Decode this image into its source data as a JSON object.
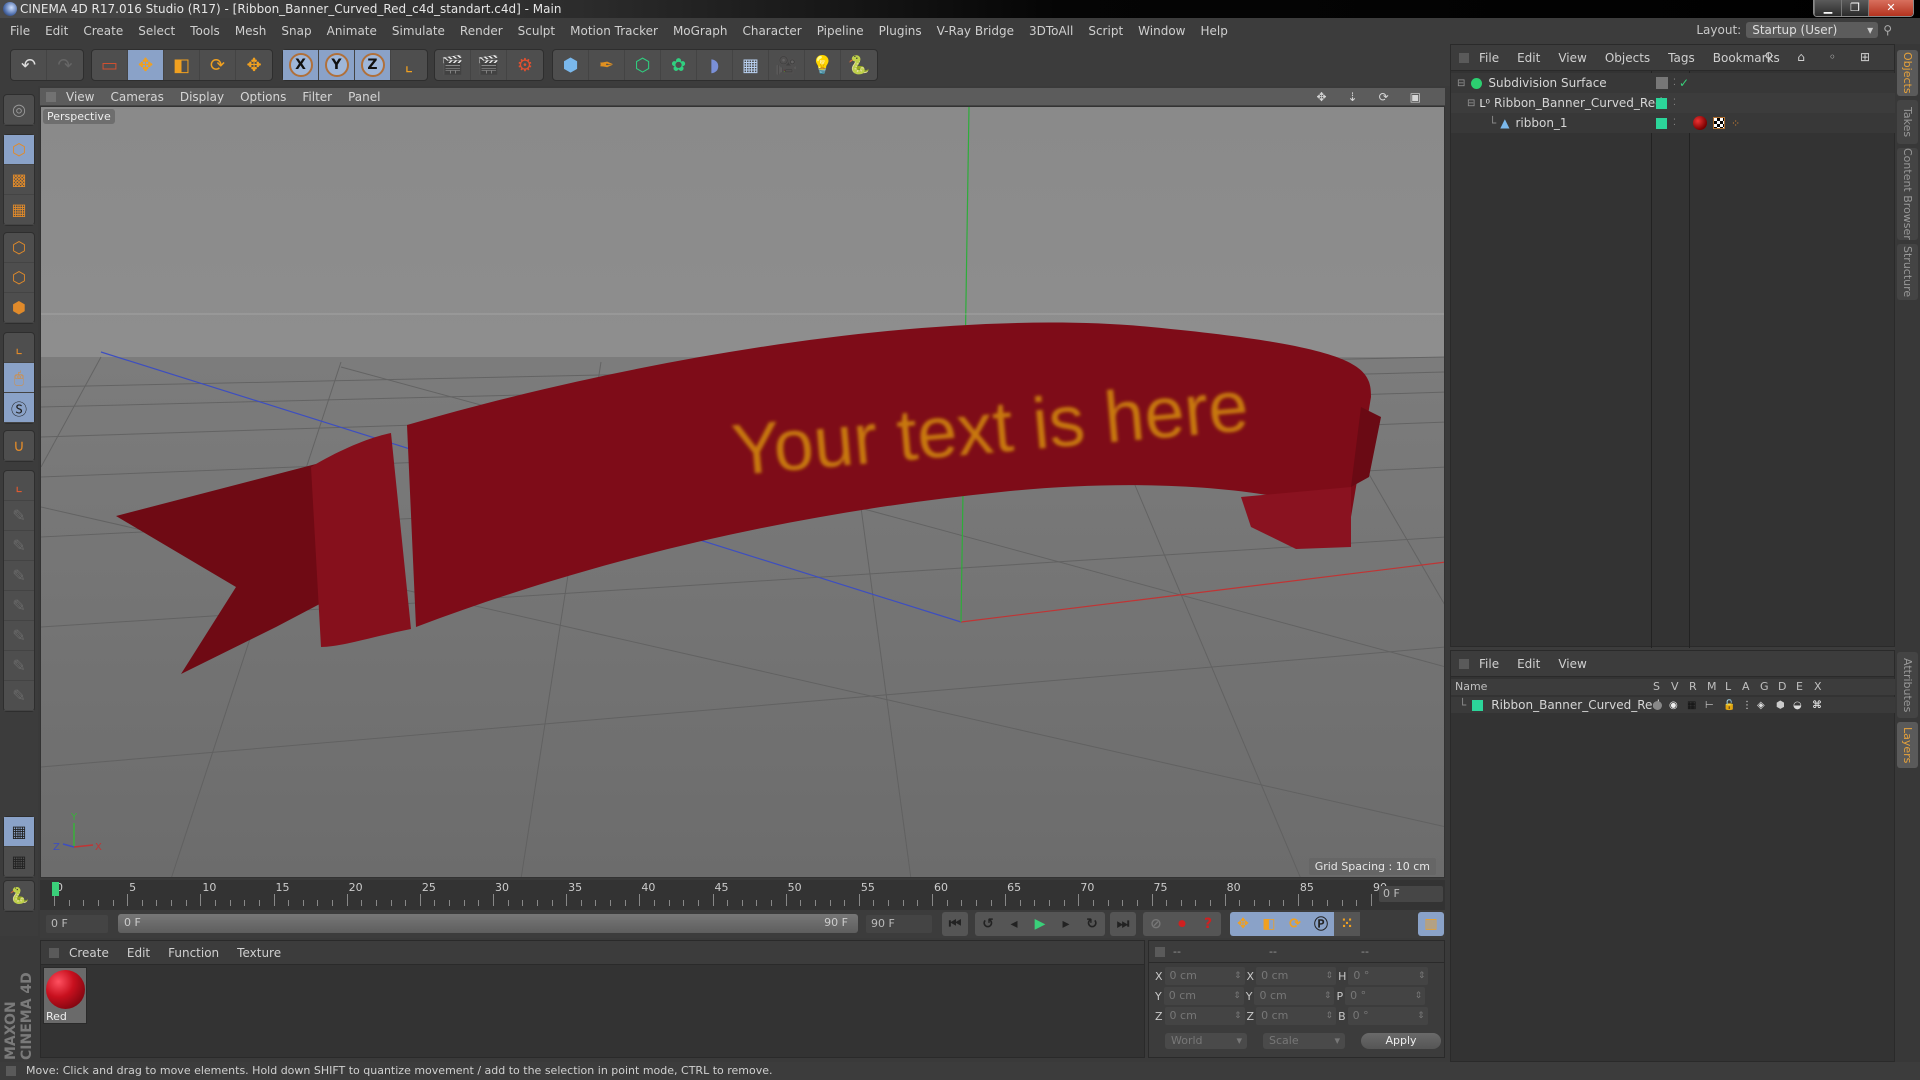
{
  "window": {
    "title": "CINEMA 4D R17.016 Studio (R17) - [Ribbon_Banner_Curved_Red_c4d_standart.c4d] - Main",
    "controls": [
      "minimize",
      "restore",
      "close"
    ]
  },
  "menubar": {
    "items": [
      "File",
      "Edit",
      "Create",
      "Select",
      "Tools",
      "Mesh",
      "Snap",
      "Animate",
      "Simulate",
      "Render",
      "Sculpt",
      "Motion Tracker",
      "MoGraph",
      "Character",
      "Pipeline",
      "Plugins",
      "V-Ray Bridge",
      "3DToAll",
      "Script",
      "Window",
      "Help"
    ],
    "layout_label": "Layout:",
    "layout_value": "Startup (User)"
  },
  "toolbar": {
    "groups": [
      [
        "undo-icon",
        "redo-icon"
      ],
      [
        "live-selection-icon",
        "move-icon",
        "scale-icon",
        "rotate-icon",
        "move-alt-icon"
      ],
      [
        "x-axis-icon",
        "y-axis-icon",
        "z-axis-icon",
        "coordinate-system-icon"
      ],
      [
        "render-view-icon",
        "render-picture-viewer-icon",
        "render-settings-icon"
      ],
      [
        "cube-icon",
        "pen-spline-icon",
        "subdivision-icon",
        "array-icon",
        "deformer-icon",
        "floor-icon",
        "camera-icon",
        "light-icon",
        "python-icon"
      ]
    ],
    "axis_labels": [
      "X",
      "Y",
      "Z"
    ]
  },
  "left_toolbar": {
    "items": [
      "make-editable",
      "model-mode",
      "texture-mode",
      "workplane-mode",
      "points-mode",
      "edges-mode",
      "polygons-mode",
      "axis-mode",
      "tweak-mode",
      "solo-mode",
      "snap",
      "workplane",
      "move-tool",
      "p-tool",
      "r-tool",
      "psr-tool",
      "target-tool",
      "scale-tool",
      "misc-tool",
      "lock-workplane",
      "workplane-rotate",
      "python"
    ]
  },
  "viewport": {
    "menu": [
      "View",
      "Cameras",
      "Display",
      "Options",
      "Filter",
      "Panel"
    ],
    "camera_label": "Perspective",
    "grid_spacing": "Grid Spacing : 10 cm",
    "banner_text": "Your text is here",
    "axis_gizmo": {
      "x": "X",
      "y": "Y",
      "z": "Z"
    },
    "colors": {
      "banner": "#7a0c17",
      "banner_text": "#c8780f",
      "grid_bg": "#7b7b7b"
    }
  },
  "object_manager": {
    "menu": [
      "File",
      "Edit",
      "View",
      "Objects",
      "Tags",
      "Bookmarks"
    ],
    "objects": [
      {
        "name": "Subdivision Surface",
        "level": 0,
        "icon": "subdivision-surface-icon",
        "enabled": true
      },
      {
        "name": "Ribbon_Banner_Curved_Red",
        "level": 1,
        "icon": "null-object-icon",
        "layer_color": "#2cd59a"
      },
      {
        "name": "ribbon_1",
        "level": 2,
        "icon": "polygon-object-icon",
        "layer_color": "#2cd59a",
        "tags": [
          "material-tag-red",
          "texture-tag",
          "phong-tag"
        ]
      }
    ]
  },
  "layer_manager": {
    "menu": [
      "File",
      "Edit",
      "View"
    ],
    "columns": [
      "Name",
      "S",
      "V",
      "R",
      "M",
      "L",
      "A",
      "G",
      "D",
      "E",
      "X"
    ],
    "layers": [
      {
        "name": "Ribbon_Banner_Curved_Red",
        "color": "#2cd59a"
      }
    ]
  },
  "side_tabs": {
    "top": [
      "Objects",
      "Takes",
      "Content Browser",
      "Structure"
    ],
    "bottom": [
      "Attributes",
      "Layers"
    ]
  },
  "timeline": {
    "ticks": [
      "0",
      "5",
      "10",
      "15",
      "20",
      "25",
      "30",
      "35",
      "40",
      "45",
      "50",
      "55",
      "60",
      "65",
      "70",
      "75",
      "80",
      "85",
      "90"
    ],
    "current_frame": "0 F",
    "start_field": "0 F",
    "range_start": "0 F",
    "range_end": "90 F",
    "end_field": "90 F"
  },
  "material_manager": {
    "menu": [
      "Create",
      "Edit",
      "Function",
      "Texture"
    ],
    "materials": [
      {
        "name": "Red",
        "color": "#c8101e"
      }
    ]
  },
  "coordinates": {
    "headers": [
      "--",
      "--",
      "--"
    ],
    "rows": [
      {
        "a": "X",
        "av": "0 cm",
        "b": "X",
        "bv": "0 cm",
        "c": "H",
        "cv": "0 °"
      },
      {
        "a": "Y",
        "av": "0 cm",
        "b": "Y",
        "bv": "0 cm",
        "c": "P",
        "cv": "0 °"
      },
      {
        "a": "Z",
        "av": "0 cm",
        "b": "Z",
        "bv": "0 cm",
        "c": "B",
        "cv": "0 °"
      }
    ],
    "space": "World",
    "mode": "Scale",
    "apply": "Apply"
  },
  "branding": "MAXON CINEMA 4D",
  "status": "Move: Click and drag to move elements. Hold down SHIFT to quantize movement / add to the selection in point mode, CTRL to remove."
}
